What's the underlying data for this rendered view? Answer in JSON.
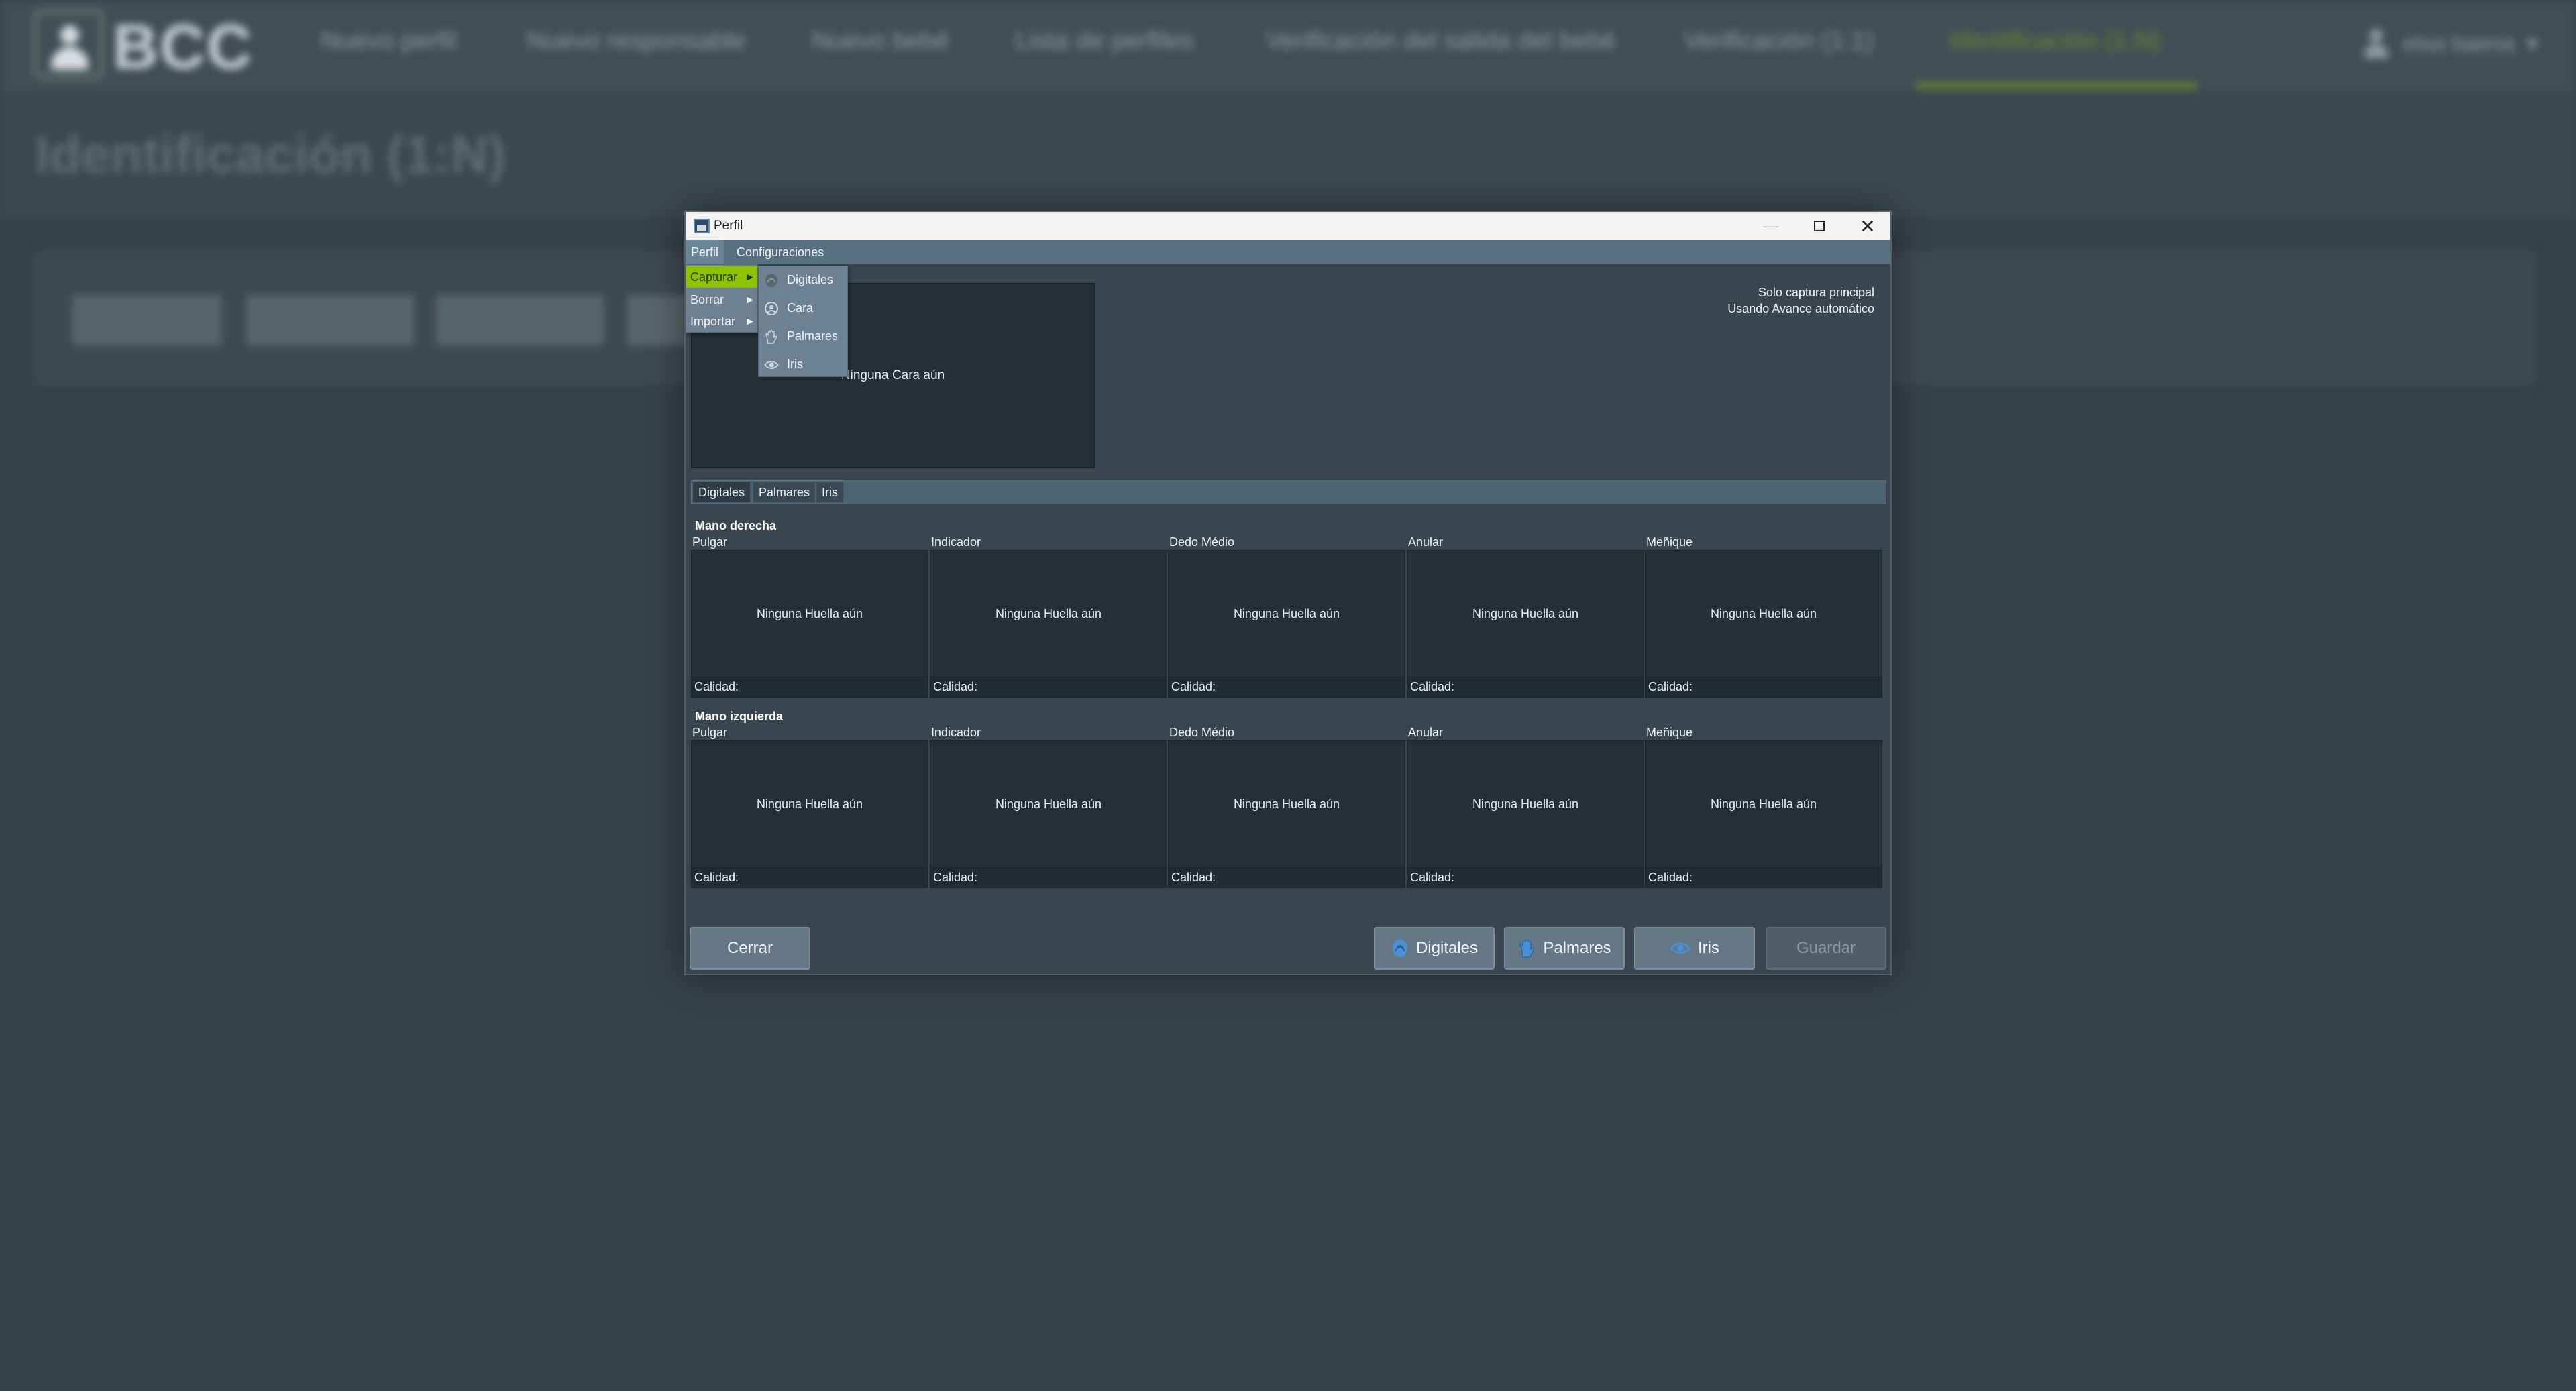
{
  "app": {
    "logo_text": "BCC",
    "nav": [
      "Nuevo perfil",
      "Nuevo responsable",
      "Nuevo bebé",
      "Lista de perfiles",
      "Verificación del salida del bebé",
      "Verificación (1:1)",
      "Identificación (1:N)"
    ],
    "active_nav": "Identificación (1:N)",
    "user_name": "elsa baena",
    "page_title": "Identificación (1:N)"
  },
  "dialog": {
    "title": "Perfil",
    "menu": [
      "Perfil",
      "Configuraciones"
    ],
    "perfil_menu": [
      "Capturar",
      "Borrar",
      "Importar"
    ],
    "capturar_submenu": [
      {
        "label": "Digitales",
        "icon": "fingerprint-icon"
      },
      {
        "label": "Cara",
        "icon": "face-icon"
      },
      {
        "label": "Palmares",
        "icon": "palm-icon"
      },
      {
        "label": "Iris",
        "icon": "eye-icon"
      }
    ],
    "status": [
      "Solo captura principal",
      "Usando Avance automático"
    ],
    "face_placeholder": "Ninguna Cara aún",
    "tabs": [
      "Digitales",
      "Palmares",
      "Iris"
    ],
    "selected_tab": "Digitales",
    "right_hand": {
      "title": "Mano derecha",
      "fingers": [
        {
          "name": "Pulgar",
          "placeholder": "Ninguna Huella aún",
          "quality": "Calidad:"
        },
        {
          "name": "Indicador",
          "placeholder": "Ninguna Huella aún",
          "quality": "Calidad:"
        },
        {
          "name": "Dedo Médio",
          "placeholder": "Ninguna Huella aún",
          "quality": "Calidad:"
        },
        {
          "name": "Anular",
          "placeholder": "Ninguna Huella aún",
          "quality": "Calidad:"
        },
        {
          "name": "Meñique",
          "placeholder": "Ninguna Huella aún",
          "quality": "Calidad:"
        }
      ]
    },
    "left_hand": {
      "title": "Mano izquierda",
      "fingers": [
        {
          "name": "Pulgar",
          "placeholder": "Ninguna Huella aún",
          "quality": "Calidad:"
        },
        {
          "name": "Indicador",
          "placeholder": "Ninguna Huella aún",
          "quality": "Calidad:"
        },
        {
          "name": "Dedo Médio",
          "placeholder": "Ninguna Huella aún",
          "quality": "Calidad:"
        },
        {
          "name": "Anular",
          "placeholder": "Ninguna Huella aún",
          "quality": "Calidad:"
        },
        {
          "name": "Meñique",
          "placeholder": "Ninguna Huella aún",
          "quality": "Calidad:"
        }
      ]
    },
    "buttons": {
      "close": "Cerrar",
      "digitales": "Digitales",
      "palmares": "Palmares",
      "iris": "Iris",
      "save": "Guardar"
    }
  },
  "colors": {
    "accent_highlight": "#8dc400",
    "nav_active": "#6e8a33",
    "menubar": "#56707f"
  }
}
